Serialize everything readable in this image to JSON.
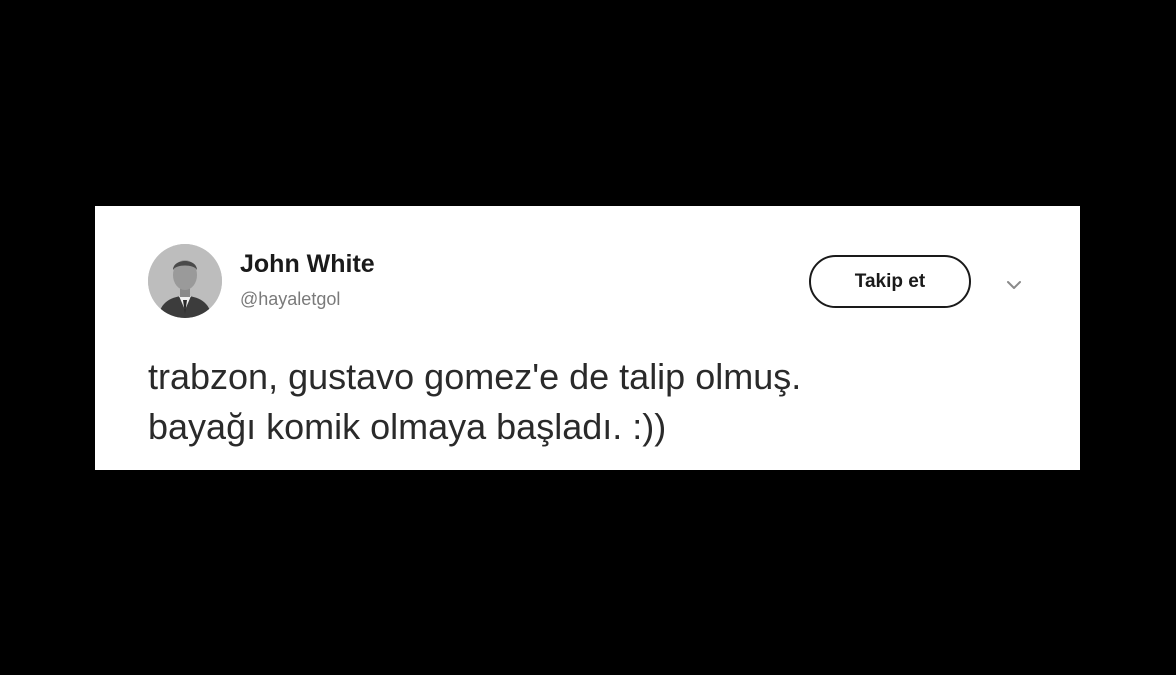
{
  "tweet": {
    "author": {
      "name": "John White",
      "handle": "@hayaletgol",
      "avatar_icon": "profile-photo"
    },
    "follow_label": "Takip et",
    "menu_icon": "chevron-down-icon",
    "lines": [
      "trabzon, gustavo gomez'e de talip olmuş.",
      "bayağı komik olmaya başladı. :))"
    ]
  },
  "colors": {
    "background": "#000000",
    "card": "#ffffff",
    "text": "#2a2a2a",
    "muted": "#7a7a7a"
  }
}
